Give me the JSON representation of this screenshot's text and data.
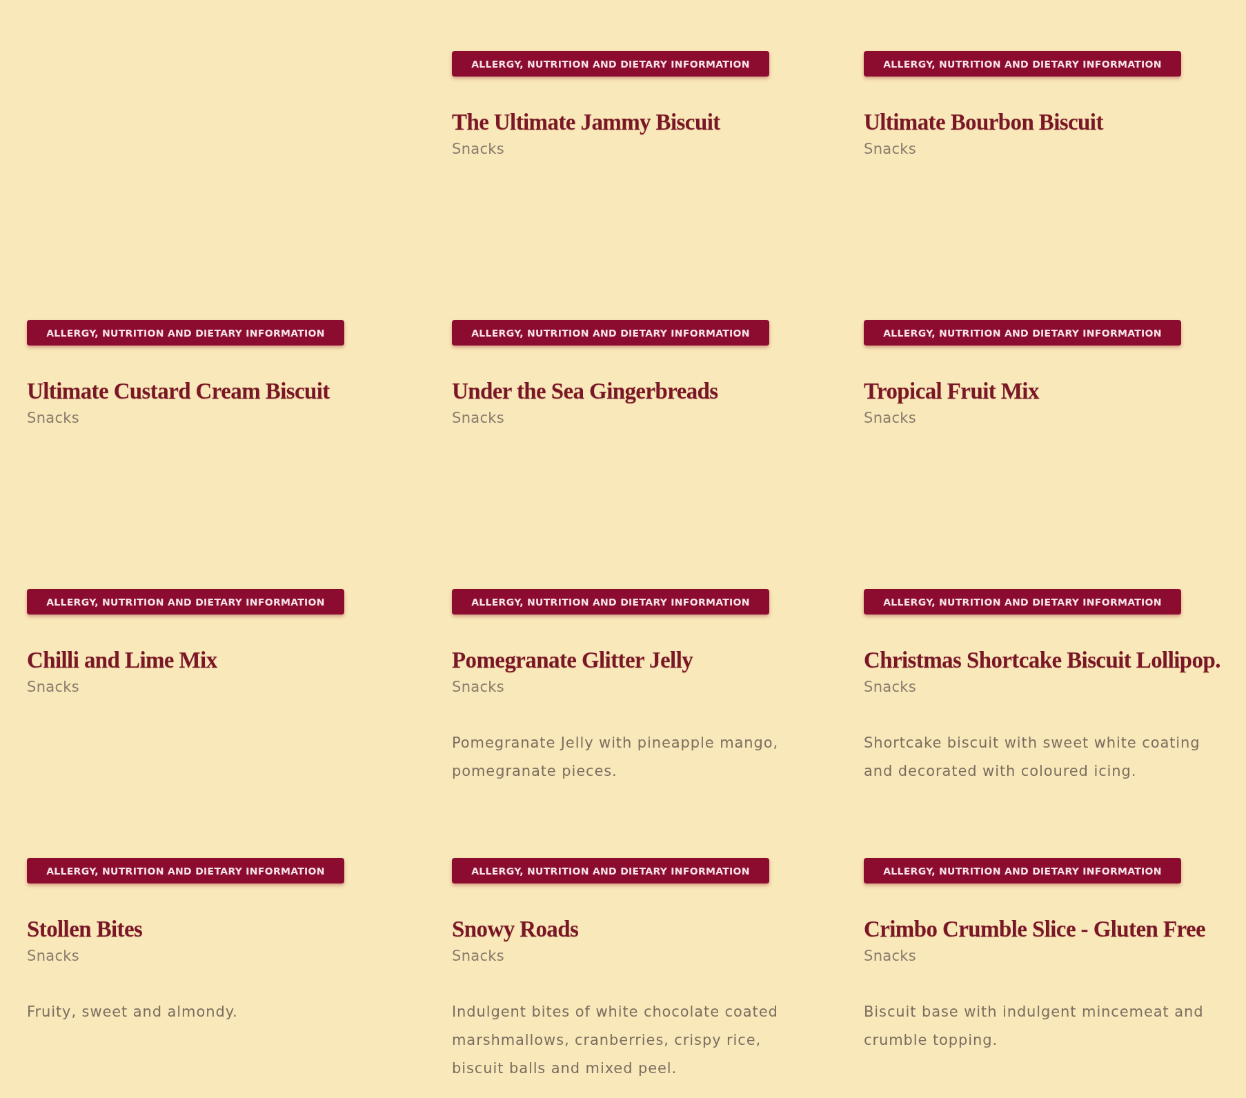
{
  "rows": [
    {
      "products": [
        {
          "button": "ALLERGY, NUTRITION AND DIETARY INFORMATION",
          "name": "The Ultimate Jammy Biscuit",
          "category": "Snacks"
        },
        {
          "button": "ALLERGY, NUTRITION AND DIETARY INFORMATION",
          "name": "Ultimate Bourbon Biscuit",
          "category": "Snacks"
        }
      ]
    },
    {
      "products": [
        {
          "button": "ALLERGY, NUTRITION AND DIETARY INFORMATION",
          "name": "Ultimate Custard Cream Biscuit",
          "category": "Snacks"
        },
        {
          "button": "ALLERGY, NUTRITION AND DIETARY INFORMATION",
          "name": "Under the Sea Gingerbreads",
          "category": "Snacks"
        },
        {
          "button": "ALLERGY, NUTRITION AND DIETARY INFORMATION",
          "name": "Tropical Fruit Mix",
          "category": "Snacks"
        }
      ]
    },
    {
      "products": [
        {
          "button": "ALLERGY, NUTRITION AND DIETARY INFORMATION",
          "name": "Chilli and Lime Mix",
          "category": "Snacks"
        },
        {
          "button": "ALLERGY, NUTRITION AND DIETARY INFORMATION",
          "name": "Pomegranate Glitter Jelly",
          "category": "Snacks",
          "description": "Pomegranate Jelly with pineapple mango, pomegranate pieces."
        },
        {
          "button": "ALLERGY, NUTRITION AND DIETARY INFORMATION",
          "name": "Christmas Shortcake Biscuit Lollipop.",
          "category": "Snacks",
          "description": "Shortcake biscuit with sweet white coating and decorated with coloured icing."
        }
      ]
    },
    {
      "products": [
        {
          "button": "ALLERGY, NUTRITION AND DIETARY INFORMATION",
          "name": "Stollen Bites",
          "category": "Snacks",
          "description": "Fruity, sweet and almondy."
        },
        {
          "button": "ALLERGY, NUTRITION AND DIETARY INFORMATION",
          "name": "Snowy Roads",
          "category": "Snacks",
          "description": "Indulgent bites of white chocolate coated marshmallows, cranberries, crispy rice, biscuit balls and mixed peel."
        },
        {
          "button": "ALLERGY, NUTRITION AND DIETARY INFORMATION",
          "name": "Crimbo Crumble Slice - Gluten Free",
          "category": "Snacks",
          "description": "Biscuit base with indulgent mincemeat and crumble topping."
        }
      ]
    }
  ]
}
